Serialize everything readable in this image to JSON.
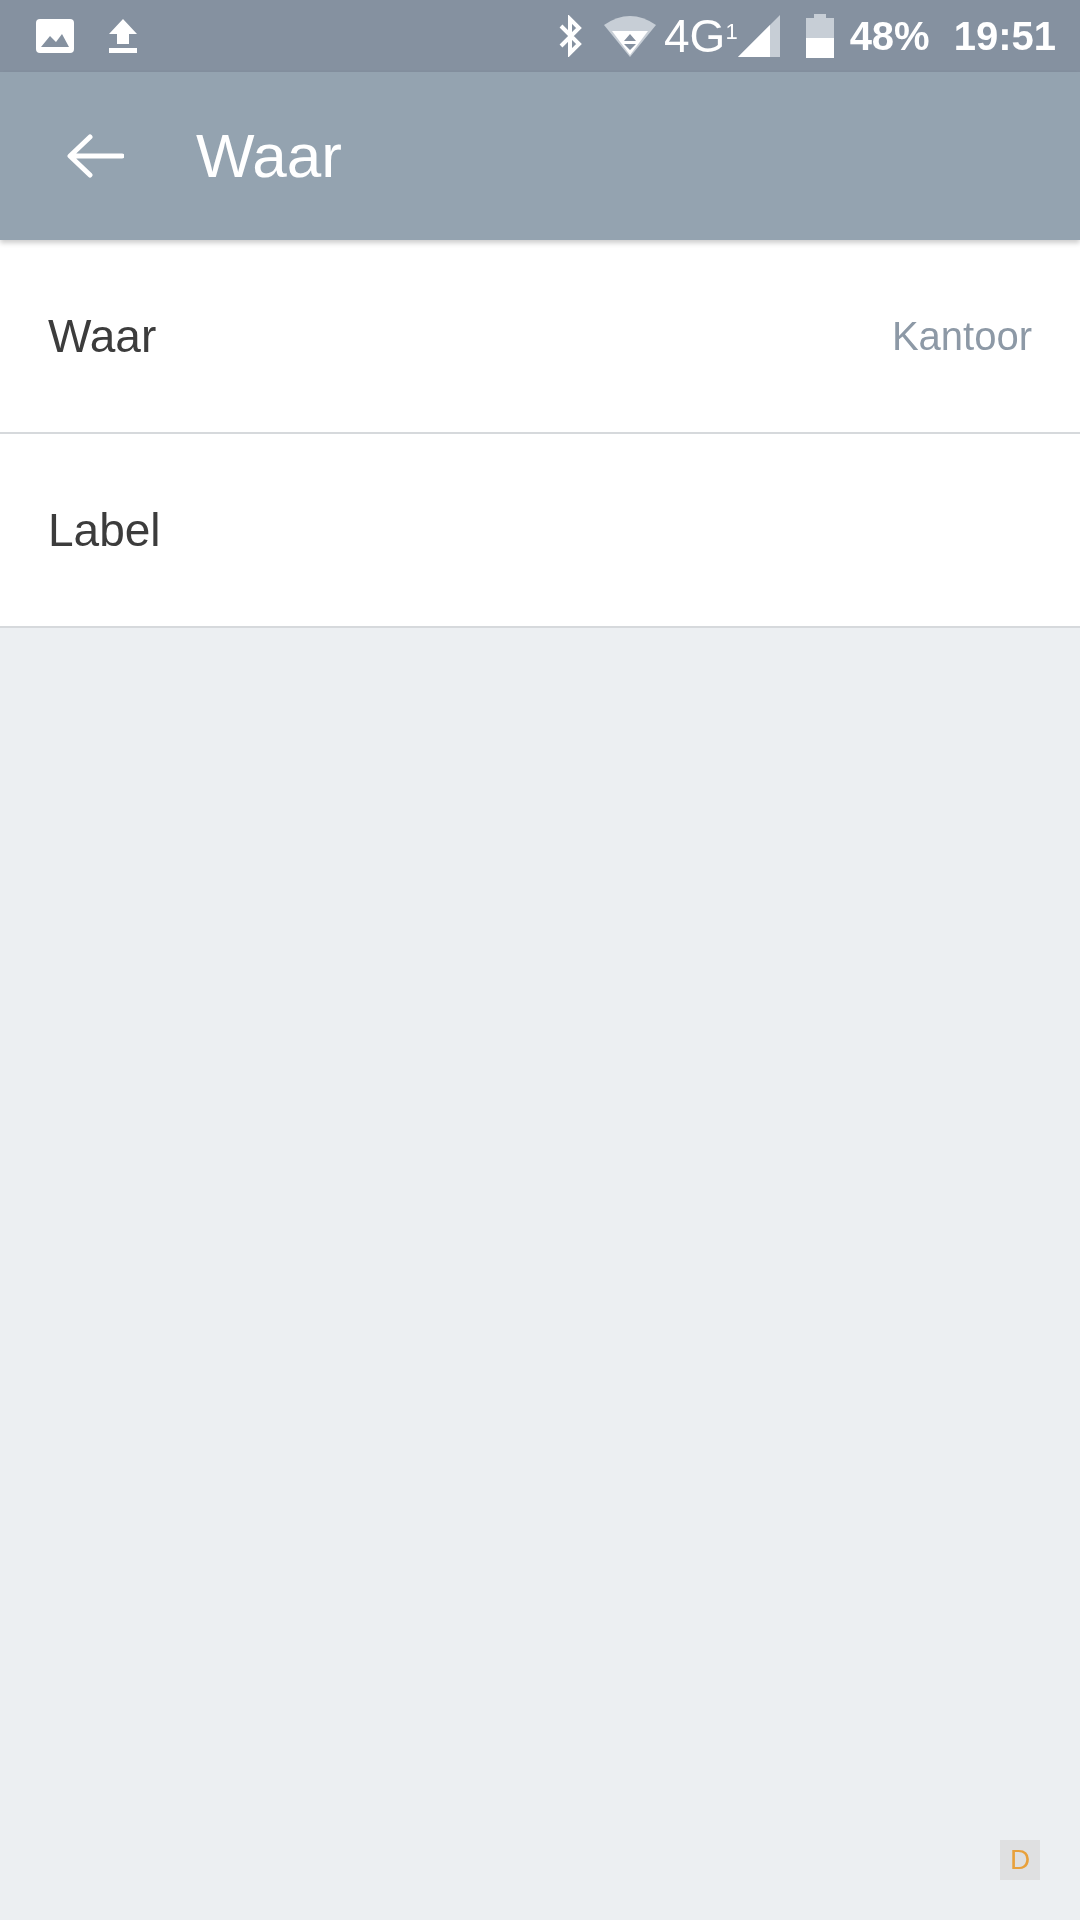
{
  "status_bar": {
    "network": "4G",
    "sim": "1",
    "battery": "48%",
    "time": "19:51"
  },
  "app_bar": {
    "title": "Waar"
  },
  "rows": [
    {
      "label": "Waar",
      "value": "Kantoor"
    },
    {
      "label": "Label"
    }
  ],
  "debug_badge": "D"
}
